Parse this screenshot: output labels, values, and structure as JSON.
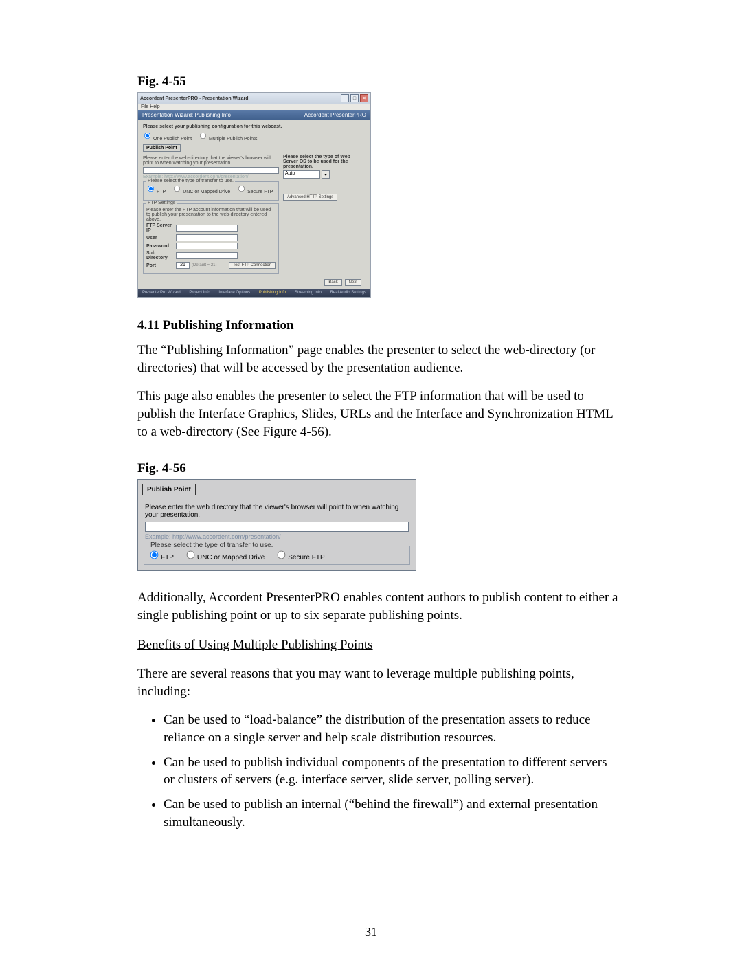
{
  "fig55_label": "Fig. 4-55",
  "shot1": {
    "titlebar": "Accordent PresenterPRO - Presentation Wizard",
    "menubar": "File   Help",
    "bluebar_left": "Presentation Wizard: Publishing Info",
    "bluebar_right": "Accordent PresenterPRO",
    "instruction": "Please select your publishing configuration for this webcast.",
    "radio_a": "One Publish Point",
    "radio_b": "Multiple Publish Points",
    "publish_point_label": "Publish Point",
    "webdir_label": "Please enter the web-directory that the viewer's browser will point to when watching your presentation.",
    "example_text": "Example: http://www.accordent.com/presentation/",
    "transfer_legend": "Please select the type of transfer to use.",
    "transfer_ftp": "FTP",
    "transfer_unc": "UNC or Mapped Drive",
    "transfer_secure": "Secure FTP",
    "ftp_legend": "FTP Settings",
    "ftp_instr": "Please enter the FTP account information that will be used to publish your presentation to the web-directory entered above.",
    "lbl_server": "FTP Server IP",
    "lbl_user": "User",
    "lbl_password": "Password",
    "lbl_subdir": "Sub Directory",
    "lbl_port": "Port",
    "port_value": "21",
    "port_default": "(Default = 21)",
    "btn_test": "Test FTP Connection",
    "right_header": "Please select the type of Web Server OS to be used for the presentation.",
    "right_dropdown_value": "Auto",
    "btn_adv": "Advanced HTTP Settings",
    "btn_back": "Back",
    "btn_next": "Next",
    "steps": {
      "s1": "PresenterPro Wizard",
      "s2": "Project Info",
      "s3": "Interface Options",
      "s4": "Publishing Info",
      "s5": "Streaming Info",
      "s6": "Real Audio Settings"
    }
  },
  "section_heading": "4.11  Publishing Information",
  "para1": "The “Publishing Information” page enables the presenter to select the web-directory (or directories) that will be accessed by the presentation audience.",
  "para2": "This page also enables the presenter to select the FTP information that will be used to publish the Interface Graphics, Slides, URLs and the Interface and Synchronization HTML to a web-directory (See Figure 4-56).",
  "fig56_label": "Fig. 4-56",
  "shot2": {
    "publish_point_label": "Publish Point",
    "webdir_label": "Please enter the web directory that the viewer's browser will point to when watching your presentation.",
    "example_text": "Example: http://www.accordent.com/presentation/",
    "transfer_legend": "Please select the type of transfer to use.",
    "opt_ftp": "FTP",
    "opt_unc": "UNC or Mapped Drive",
    "opt_secure": "Secure  FTP"
  },
  "para3": "Additionally, Accordent PresenterPRO enables content authors to publish content to either a single publishing point or up to six separate publishing points.",
  "subheading": "Benefits of Using Multiple Publishing Points",
  "para4": "There are several reasons that you may want to leverage multiple publishing points, including:",
  "bullets": {
    "b1": "Can be used to “load-balance” the distribution of the presentation assets to reduce reliance on a single server and help scale distribution resources.",
    "b2": "Can be used to publish individual components of the presentation to different servers or clusters of servers (e.g. interface server, slide server, polling server).",
    "b3": "Can be used to publish an internal (“behind the firewall”) and external presentation simultaneously."
  },
  "page_number": "31"
}
